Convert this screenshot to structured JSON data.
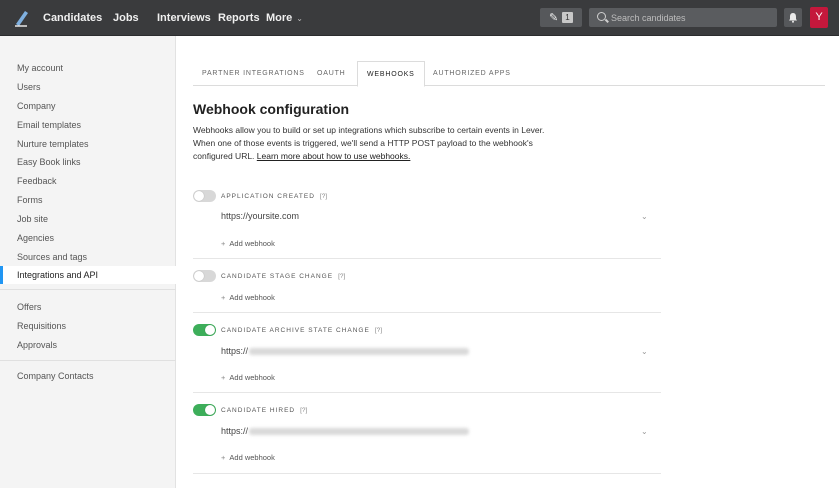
{
  "nav": {
    "items": [
      "Candidates",
      "Jobs",
      "Interviews",
      "Reports",
      "More"
    ],
    "compose_count": "1",
    "search_placeholder": "Search candidates",
    "avatar_initial": "Y"
  },
  "sidebar": {
    "group1": [
      "My account",
      "Users",
      "Company",
      "Email templates",
      "Nurture templates",
      "Easy Book links",
      "Feedback",
      "Forms",
      "Job site",
      "Agencies",
      "Sources and tags",
      "Integrations and API"
    ],
    "group2": [
      "Offers",
      "Requisitions",
      "Approvals"
    ],
    "group3": [
      "Company Contacts"
    ],
    "active": "Integrations and API"
  },
  "tabs": [
    "PARTNER INTEGRATIONS",
    "OAUTH",
    "WEBHOOKS",
    "AUTHORIZED APPS"
  ],
  "active_tab": "WEBHOOKS",
  "page": {
    "title": "Webhook configuration",
    "description": "Webhooks allow you to build or set up integrations which subscribe to certain events in Lever. When one of those events is triggered, we'll send a HTTP POST payload to the webhook's configured URL. ",
    "learn_more": "Learn more about how to use webhooks."
  },
  "webhooks": [
    {
      "title": "APPLICATION CREATED",
      "help": "[?]",
      "enabled": false,
      "url": "https://yoursite.com",
      "add_label": "Add webhook"
    },
    {
      "title": "CANDIDATE STAGE CHANGE",
      "help": "[?]",
      "enabled": false,
      "url": "",
      "add_label": "Add webhook"
    },
    {
      "title": "CANDIDATE ARCHIVE STATE CHANGE",
      "help": "[?]",
      "enabled": true,
      "url": "https://",
      "add_label": "Add webhook"
    },
    {
      "title": "CANDIDATE HIRED",
      "help": "[?]",
      "enabled": true,
      "url": "https://",
      "add_label": "Add webhook"
    }
  ],
  "colors": {
    "accent": "#2196f3",
    "toggle_on": "#3dae5a",
    "avatar": "#c4183c",
    "topbar": "#3a3b3d"
  }
}
